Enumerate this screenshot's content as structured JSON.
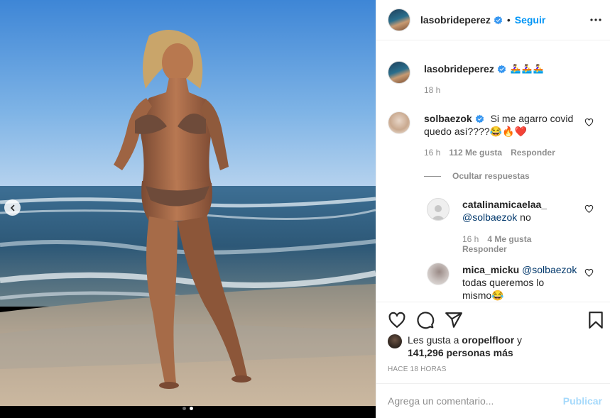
{
  "post": {
    "author": "lasobrideperez",
    "follow_label": "Seguir",
    "separator": "•",
    "caption_emoji": "🚣‍♀️🚣‍♀️🚣‍♀️",
    "caption_time": "18 h",
    "carousel": {
      "slides": 2,
      "active_slide": 2
    }
  },
  "comments": [
    {
      "username": "solbaezok",
      "text_line1": "Si me agarro covid",
      "text_line2": "quedo así????😂🔥❤️",
      "time": "16 h",
      "likes": "112 Me gusta",
      "reply_label": "Responder",
      "hide_replies_label": "Ocultar respuestas",
      "replies": [
        {
          "username": "catalinamicaelaa_",
          "mention": "@solbaezok",
          "text": " no",
          "time": "16 h",
          "likes": "4 Me gusta",
          "reply_label": "Responder"
        },
        {
          "username": "mica_micku",
          "mention": "@solbaezok",
          "text_line1": "todas queremos lo",
          "text_line2": "mismo😂"
        }
      ]
    }
  ],
  "likes": {
    "prefix": "Les gusta a ",
    "first_user": "oropelfloor",
    "joiner": " y",
    "count_text": "141,296 personas más"
  },
  "time_ago": "HACE 18 HORAS",
  "add_comment": {
    "placeholder": "Agrega un comentario...",
    "publish_label": "Publicar"
  },
  "icons": {
    "like": "heart-icon",
    "comment": "comment-icon",
    "share": "share-icon",
    "save": "bookmark-icon",
    "more": "more-options-icon",
    "verified": "verified-badge-icon"
  },
  "colors": {
    "link_blue": "#0095f6",
    "verified_blue": "#3897f0",
    "text_primary": "#262626",
    "text_secondary": "#8e8e8e",
    "mention": "#00376b",
    "heart_red": "#ed4956"
  }
}
